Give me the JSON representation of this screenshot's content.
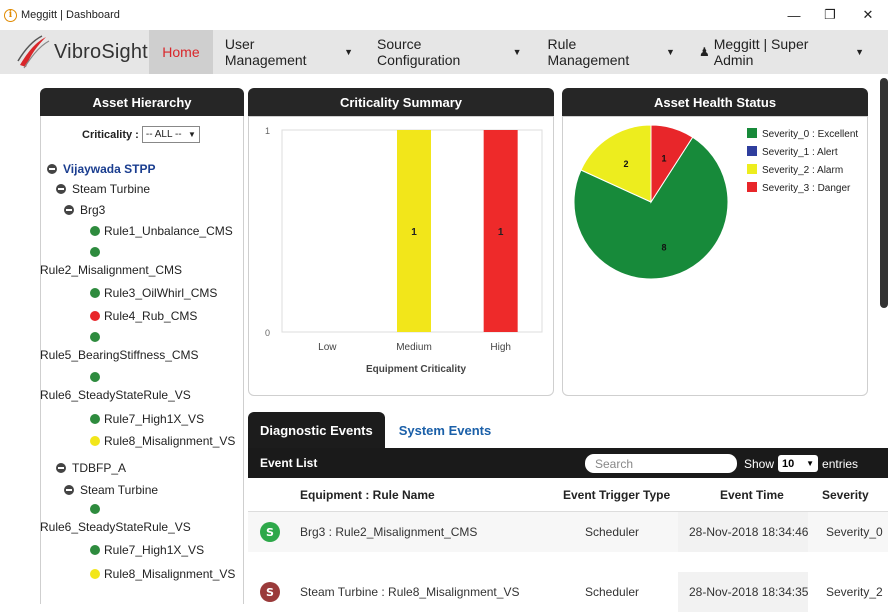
{
  "window": {
    "title": "Meggitt | Dashboard",
    "minimize": "—",
    "restore": "❐",
    "close": "✕"
  },
  "nav": {
    "logo": "VibroSight",
    "items": [
      "Home",
      "User Management",
      "Source Configuration",
      "Rule Management"
    ],
    "user": "Meggitt | Super Admin"
  },
  "asset_hierarchy": {
    "title": "Asset Hierarchy",
    "criticality_label": "Criticality :",
    "criticality_value": "-- ALL --",
    "tree": [
      {
        "label": "Vijaywada STPP",
        "kind": "root"
      },
      {
        "label": "Steam Turbine",
        "kind": "node"
      },
      {
        "label": "Brg3",
        "kind": "node"
      },
      {
        "label": "Rule1_Unbalance_CMS",
        "kind": "leaf"
      },
      {
        "label": "Rule2_Misalignment_CMS",
        "kind": "leaf"
      },
      {
        "label": "Rule3_OilWhirl_CMS",
        "kind": "leaf"
      },
      {
        "label": "Rule4_Rub_CMS",
        "kind": "leaf"
      },
      {
        "label": "Rule5_BearingStiffness_CMS",
        "kind": "leaf"
      },
      {
        "label": "Rule6_SteadyStateRule_VS",
        "kind": "leaf"
      },
      {
        "label": "Rule7_High1X_VS",
        "kind": "leaf"
      },
      {
        "label": "Rule8_Misalignment_VS",
        "kind": "leaf"
      },
      {
        "label": "TDBFP_A",
        "kind": "node"
      },
      {
        "label": "Steam Turbine",
        "kind": "node"
      },
      {
        "label": "Rule6_SteadyStateRule_VS",
        "kind": "leaf"
      },
      {
        "label": "Rule7_High1X_VS",
        "kind": "leaf"
      },
      {
        "label": "Rule8_Misalignment_VS",
        "kind": "leaf"
      }
    ]
  },
  "criticality_summary": {
    "title": "Criticality Summary"
  },
  "asset_health": {
    "title": "Asset Health Status"
  },
  "chart_data": [
    {
      "type": "bar",
      "categories": [
        "Low",
        "Medium",
        "High"
      ],
      "values": [
        0,
        1,
        1
      ],
      "colors": [
        "#f2e61a",
        "#f2e61a",
        "#ee2a2a"
      ],
      "xlabel": "Equipment Criticality",
      "ylabel": "",
      "ylim": [
        0,
        1
      ],
      "yticks": [
        "0",
        "1"
      ]
    },
    {
      "type": "pie",
      "labels": [
        "Severity_0 : Excellent",
        "Severity_1 : Alert",
        "Severity_2 : Alarm",
        "Severity_3 : Danger"
      ],
      "values": [
        8,
        0,
        2,
        1
      ],
      "colors": [
        "#178a3a",
        "#2f3e9e",
        "#eded1e",
        "#e8262a"
      ],
      "legend": "right"
    }
  ],
  "events": {
    "tabs": [
      "Diagnostic Events",
      "System Events"
    ],
    "list_title": "Event List",
    "search_placeholder": "Search",
    "show_label": "Show",
    "show_value": "10",
    "entries_label": "entries",
    "columns": [
      "Equipment : Rule Name",
      "Event Trigger Type",
      "Event Time",
      "Severity"
    ],
    "rows": [
      {
        "badge": "S",
        "badge_color": "#2ea84a",
        "name": "Brg3 : Rule2_Misalignment_CMS",
        "trigger": "Scheduler",
        "time": "28-Nov-2018 18:34:46",
        "severity": "Severity_0"
      },
      {
        "badge": "S",
        "badge_color": "#9a3a3a",
        "name": "Steam Turbine : Rule8_Misalignment_VS",
        "trigger": "Scheduler",
        "time": "28-Nov-2018 18:34:35",
        "severity": "Severity_2"
      }
    ]
  }
}
